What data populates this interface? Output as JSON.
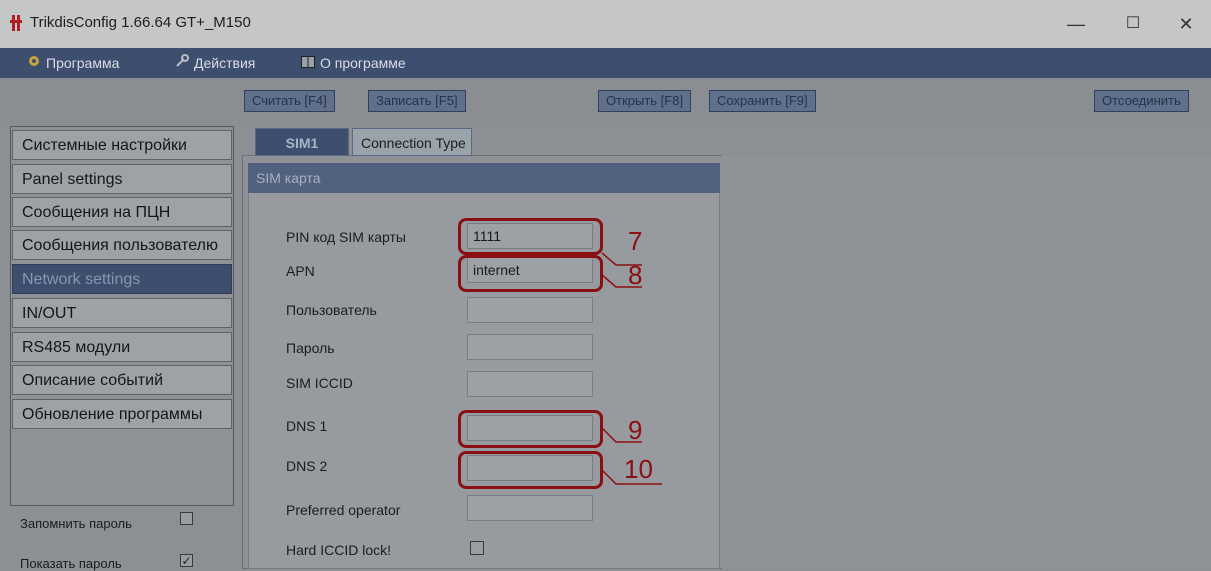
{
  "window": {
    "title": "TrikdisConfig 1.66.64   GT+_M150",
    "controls": {
      "minimize": "—",
      "maximize": "☐",
      "close": "✕"
    }
  },
  "menu": {
    "items": [
      {
        "label": "Программа",
        "icon": "gear-icon"
      },
      {
        "label": "Действия",
        "icon": "wrench-icon"
      },
      {
        "label": "О программе",
        "icon": "book-icon"
      }
    ]
  },
  "toolbar": {
    "read": "Считать [F4]",
    "write": "Записать [F5]",
    "open": "Открыть [F8]",
    "save": "Сохранить [F9]",
    "disconnect": "Отсоединить"
  },
  "sidebar": {
    "items": [
      "Системные настройки",
      "Panel settings",
      "Сообщения на ПЦН",
      "Сообщения пользователю",
      "Network settings",
      "IN/OUT",
      "RS485 модули",
      "Описание событий",
      "Обновление программы"
    ],
    "active_index": 4,
    "remember_password": "Запомнить пароль",
    "remember_password_checked": false,
    "show_password": "Показать пароль",
    "show_password_checked": true
  },
  "tabs": [
    "SIM1",
    "Connection Type"
  ],
  "sim_group": {
    "title": "SIM карта",
    "fields": [
      {
        "label": "PIN код SIM карты",
        "value": "1111"
      },
      {
        "label": "APN",
        "value": "internet"
      },
      {
        "label": "Пользователь",
        "value": ""
      },
      {
        "label": "Пароль",
        "value": ""
      },
      {
        "label": "SIM ICCID",
        "value": ""
      },
      {
        "label": "DNS 1",
        "value": ""
      },
      {
        "label": "DNS 2",
        "value": ""
      },
      {
        "label": "Preferred operator",
        "value": ""
      }
    ],
    "hard_iccid_label": "Hard ICCID lock!",
    "hard_iccid_checked": false
  },
  "annotations": [
    "7",
    "8",
    "9",
    "10"
  ],
  "colors": {
    "accent": "#3e4e6e",
    "highlight": "#8a0f12"
  }
}
